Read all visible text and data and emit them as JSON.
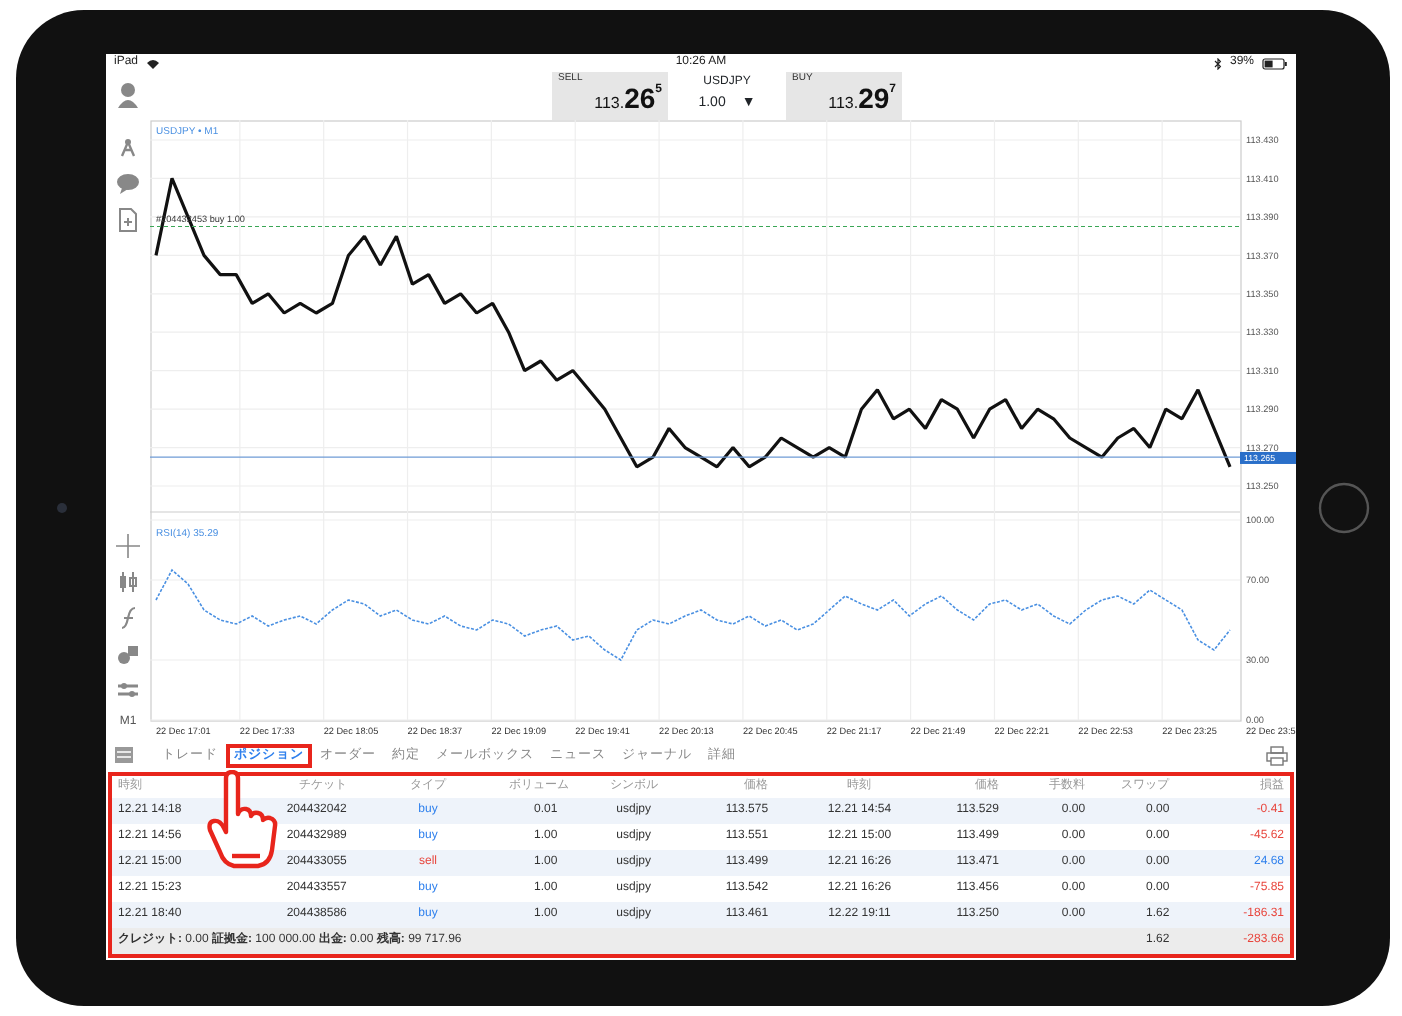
{
  "status_bar": {
    "device": "iPad",
    "time": "10:26 AM",
    "battery": "39%"
  },
  "quote_bar": {
    "sell": {
      "label": "SELL",
      "price_small": "113.",
      "price_big": "26",
      "price_sup": "5"
    },
    "symbol": {
      "name": "USDJPY",
      "volume": "1.00",
      "caret": "▼"
    },
    "buy": {
      "label": "BUY",
      "price_small": "113.",
      "price_big": "29",
      "price_sup": "7"
    }
  },
  "main_chart": {
    "title_suffix": "• M1",
    "order_line": "#204432453 buy 1.00",
    "current_price": "113.265",
    "chart_data": {
      "type": "line",
      "grid": true,
      "ylim": [
        113.25,
        113.43
      ],
      "yticks": [
        {
          "value": 113.43,
          "label": "113.430"
        },
        {
          "value": 113.41,
          "label": "113.410"
        },
        {
          "value": 113.39,
          "label": "113.390"
        },
        {
          "value": 113.37,
          "label": "113.370"
        },
        {
          "value": 113.35,
          "label": "113.350"
        },
        {
          "value": 113.33,
          "label": "113.330"
        },
        {
          "value": 113.31,
          "label": "113.310"
        },
        {
          "value": 113.29,
          "label": "113.290"
        },
        {
          "value": 113.27,
          "label": "113.270"
        },
        {
          "value": 113.25,
          "label": "113.250"
        }
      ],
      "series": [
        {
          "name": "USDJPY",
          "color": "#111111",
          "line_style": "solid",
          "values": [
            113.37,
            113.41,
            113.39,
            113.37,
            113.36,
            113.36,
            113.345,
            113.35,
            113.34,
            113.345,
            113.34,
            113.345,
            113.37,
            113.38,
            113.365,
            113.38,
            113.355,
            113.36,
            113.345,
            113.35,
            113.34,
            113.345,
            113.33,
            113.31,
            113.315,
            113.305,
            113.31,
            113.3,
            113.29,
            113.275,
            113.26,
            113.265,
            113.28,
            113.27,
            113.265,
            113.26,
            113.27,
            113.26,
            113.265,
            113.275,
            113.27,
            113.265,
            113.27,
            113.265,
            113.29,
            113.3,
            113.285,
            113.29,
            113.28,
            113.295,
            113.29,
            113.275,
            113.29,
            113.295,
            113.28,
            113.29,
            113.285,
            113.275,
            113.27,
            113.265,
            113.275,
            113.28,
            113.27,
            113.29,
            113.285,
            113.3,
            113.28,
            113.26
          ]
        }
      ]
    }
  },
  "rsi_chart": {
    "title_suffix": "35.29",
    "chart_data": {
      "type": "line",
      "grid": true,
      "ylim": [
        0,
        100
      ],
      "yticks": [
        {
          "value": 100,
          "label": "100.00"
        },
        {
          "value": 70,
          "label": "70.00"
        },
        {
          "value": 30,
          "label": "30.00"
        },
        {
          "value": 0,
          "label": "0.00"
        }
      ],
      "series": [
        {
          "name": "RSI(14)",
          "color": "#4a90e2",
          "line_style": "dashed",
          "values": [
            60,
            75,
            68,
            55,
            50,
            48,
            52,
            47,
            50,
            52,
            48,
            55,
            60,
            58,
            52,
            55,
            50,
            48,
            52,
            47,
            45,
            50,
            48,
            42,
            45,
            47,
            40,
            42,
            35,
            30,
            45,
            50,
            48,
            52,
            55,
            50,
            48,
            52,
            47,
            50,
            45,
            48,
            55,
            62,
            58,
            55,
            60,
            52,
            58,
            62,
            55,
            50,
            58,
            60,
            55,
            58,
            52,
            48,
            55,
            60,
            62,
            58,
            65,
            60,
            55,
            40,
            35,
            45
          ]
        }
      ]
    }
  },
  "time_labels": [
    "22 Dec 17:01",
    "22 Dec 17:33",
    "22 Dec 18:05",
    "22 Dec 18:37",
    "22 Dec 19:09",
    "22 Dec 19:41",
    "22 Dec 20:13",
    "22 Dec 20:45",
    "22 Dec 21:17",
    "22 Dec 21:49",
    "22 Dec 22:21",
    "22 Dec 22:53",
    "22 Dec 23:25",
    "22 Dec 23:5"
  ],
  "side_toolbar": {
    "timeframe": "M1"
  },
  "tabs": [
    {
      "label": "トレード",
      "selected": false
    },
    {
      "label": "ポジション",
      "selected": true
    },
    {
      "label": "オーダー",
      "selected": false
    },
    {
      "label": "約定",
      "selected": false
    },
    {
      "label": "メールボックス",
      "selected": false
    },
    {
      "label": "ニュース",
      "selected": false
    },
    {
      "label": "ジャーナル",
      "selected": false
    },
    {
      "label": "詳細",
      "selected": false
    }
  ],
  "table": {
    "columns": [
      "時刻",
      "チケット",
      "タイプ",
      "ボリューム",
      "シンボル",
      "価格",
      "時刻",
      "価格",
      "手数料",
      "スワップ",
      "損益"
    ],
    "rows": [
      {
        "cells": [
          {
            "text": "12.21 14:18"
          },
          {
            "text": "204432042"
          },
          {
            "text": "buy",
            "color": "#2f80ed"
          },
          {
            "text": "0.01"
          },
          {
            "text": "usdjpy"
          },
          {
            "text": "113.575"
          },
          {
            "text": "12.21 14:54"
          },
          {
            "text": "113.529"
          },
          {
            "text": "0.00"
          },
          {
            "text": "0.00"
          },
          {
            "text": "-0.41",
            "color": "#e8453c"
          }
        ]
      },
      {
        "cells": [
          {
            "text": "12.21 14:56"
          },
          {
            "text": "204432989"
          },
          {
            "text": "buy",
            "color": "#2f80ed"
          },
          {
            "text": "1.00"
          },
          {
            "text": "usdjpy"
          },
          {
            "text": "113.551"
          },
          {
            "text": "12.21 15:00"
          },
          {
            "text": "113.499"
          },
          {
            "text": "0.00"
          },
          {
            "text": "0.00"
          },
          {
            "text": "-45.62",
            "color": "#e8453c"
          }
        ]
      },
      {
        "cells": [
          {
            "text": "12.21 15:00"
          },
          {
            "text": "204433055"
          },
          {
            "text": "sell",
            "color": "#e8453c"
          },
          {
            "text": "1.00"
          },
          {
            "text": "usdjpy"
          },
          {
            "text": "113.499"
          },
          {
            "text": "12.21 16:26"
          },
          {
            "text": "113.471"
          },
          {
            "text": "0.00"
          },
          {
            "text": "0.00"
          },
          {
            "text": "24.68",
            "color": "#2f80ed"
          }
        ]
      },
      {
        "cells": [
          {
            "text": "12.21 15:23"
          },
          {
            "text": "204433557"
          },
          {
            "text": "buy",
            "color": "#2f80ed"
          },
          {
            "text": "1.00"
          },
          {
            "text": "usdjpy"
          },
          {
            "text": "113.542"
          },
          {
            "text": "12.21 16:26"
          },
          {
            "text": "113.456"
          },
          {
            "text": "0.00"
          },
          {
            "text": "0.00"
          },
          {
            "text": "-75.85",
            "color": "#e8453c"
          }
        ]
      },
      {
        "cells": [
          {
            "text": "12.21 18:40"
          },
          {
            "text": "204438586"
          },
          {
            "text": "buy",
            "color": "#2f80ed"
          },
          {
            "text": "1.00"
          },
          {
            "text": "usdjpy"
          },
          {
            "text": "113.461"
          },
          {
            "text": "12.22 19:11"
          },
          {
            "text": "113.250"
          },
          {
            "text": "0.00"
          },
          {
            "text": "1.62"
          },
          {
            "text": "-186.31",
            "color": "#e8453c"
          }
        ]
      }
    ],
    "footer": {
      "summary": "**クレジット:** 0.00 **証拠金:** 100 000.00 **出金:** 0.00 **残高:** 99 717.96",
      "swap_total": "1.62",
      "profit_total": {
        "text": "-283.66",
        "color": "#e8453c"
      }
    }
  }
}
